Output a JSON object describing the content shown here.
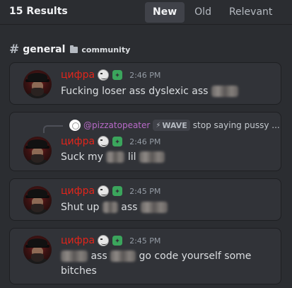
{
  "header": {
    "results_count": "15 Results",
    "tabs": [
      {
        "label": "New",
        "active": true
      },
      {
        "label": "Old",
        "active": false
      },
      {
        "label": "Relevant",
        "active": false
      }
    ]
  },
  "channel": {
    "hash": "#",
    "name": "general",
    "category_icon": "folder-icon",
    "category": "community"
  },
  "messages": [
    {
      "username": "цифра",
      "username_color": "#e1251b",
      "timestamp": "2:46 PM",
      "parts": [
        "Fucking loser ass dyslexic ass"
      ]
    },
    {
      "username": "цифра",
      "timestamp": "2:46 PM",
      "reply": {
        "name": "@pizzatopeater",
        "tag": "WAVE",
        "tag_icon": "bolt-icon",
        "text": "stop saying pussy ..."
      },
      "parts": [
        "Suck my",
        "lil"
      ]
    },
    {
      "username": "цифра",
      "timestamp": "2:45 PM",
      "parts": [
        "Shut up",
        "ass"
      ]
    },
    {
      "username": "цифра",
      "timestamp": "2:45 PM",
      "parts": [
        "ass",
        "go code yourself some bitches"
      ]
    }
  ],
  "colors": {
    "background": "#2b2d31",
    "card": "#313338",
    "username": "#e1251b",
    "reply_name": "#b86ac8"
  }
}
